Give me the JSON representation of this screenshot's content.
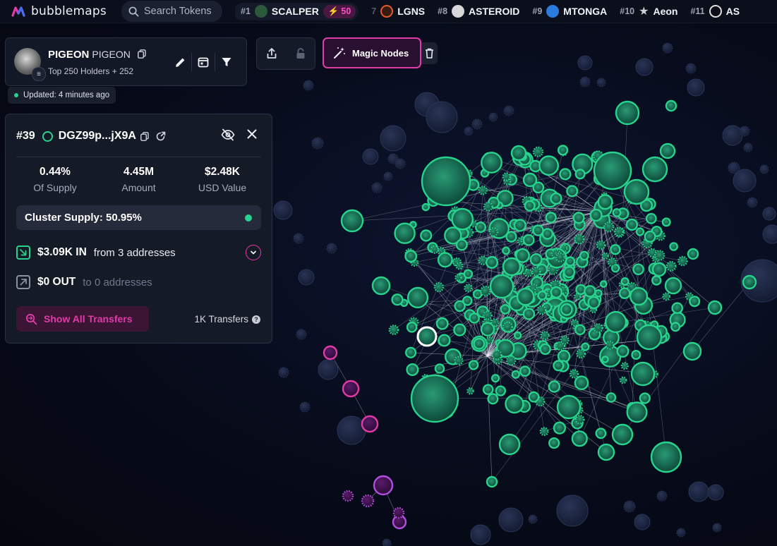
{
  "app": {
    "name": "bubblemaps"
  },
  "search": {
    "placeholder": "Search Tokens"
  },
  "ticker": [
    {
      "rank": "#1",
      "name": "SCALPER",
      "boost": "50",
      "icon": "scalper-logo",
      "color": "#3a9a5a"
    },
    {
      "rank": "7",
      "name": "LGNS",
      "icon": "lgns-logo",
      "color": "#e05a2a"
    },
    {
      "rank": "#8",
      "name": "ASTEROID",
      "icon": "asteroid-logo",
      "color": "#d7d7d7"
    },
    {
      "rank": "#9",
      "name": "MTONGA",
      "icon": "mtonga-logo",
      "color": "#2a7be0"
    },
    {
      "rank": "#10",
      "name": "Aeon",
      "icon": "aeon-logo",
      "color": "#bbbbbb"
    },
    {
      "rank": "#11",
      "name": "AS",
      "icon": "as-logo",
      "color": "#dddddd"
    }
  ],
  "token": {
    "name": "PIGEON",
    "symbol": "PIGEON",
    "subtitle": "Top 250 Holders + 252",
    "updated": "Updated: 4 minutes ago"
  },
  "toolbar": {
    "magic_label": "Magic Nodes"
  },
  "wallet": {
    "rank": "#39",
    "address": "DGZ99p...jX9A",
    "stats": [
      {
        "value": "0.44%",
        "label": "Of Supply"
      },
      {
        "value": "4.45M",
        "label": "Amount"
      },
      {
        "value": "$2.48K",
        "label": "USD Value"
      }
    ],
    "cluster_supply": "Cluster Supply: 50.95%",
    "in_amount": "$3.09K IN",
    "in_desc": "from 3 addresses",
    "out_amount": "$0 OUT",
    "out_desc": "to 0 addresses",
    "show_transfers": "Show All Transfers",
    "transfers_count": "1K Transfers"
  },
  "colors": {
    "accent": "#e23aa7",
    "cluster_green": "#27d38d",
    "cluster_purple": "#b14ee0",
    "background": "#070b1a"
  }
}
